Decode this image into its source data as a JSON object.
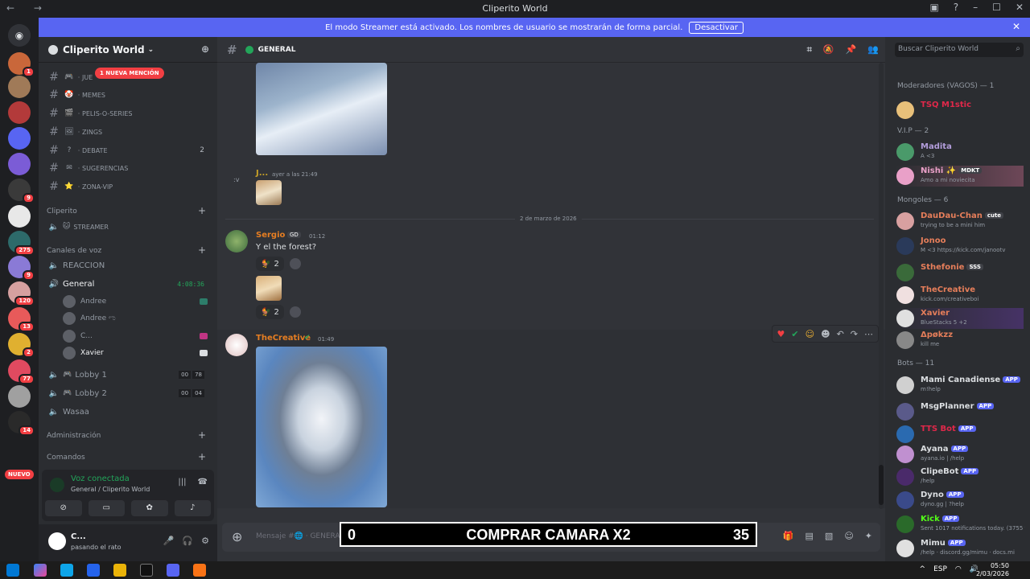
{
  "window": {
    "title": "Cliperito World",
    "nav": "← →"
  },
  "banner": {
    "text": "El modo Streamer está activado. Los nombres de usuario se mostrarán de forma parcial.",
    "button": "Desactivar"
  },
  "servers": [
    {
      "badge": "1",
      "color": "#c9673a"
    },
    {
      "badge": "",
      "color": "#a07a58"
    },
    {
      "badge": "",
      "color": "#b33a3a"
    },
    {
      "badge": "",
      "color": "#5865f2"
    },
    {
      "badge": "",
      "color": "#7b5cd6"
    },
    {
      "badge": "9",
      "color": "#3a3a3a"
    },
    {
      "badge": "",
      "color": "#e8e8e8"
    },
    {
      "badge": "275",
      "color": "#2d6a6a"
    },
    {
      "badge": "9",
      "color": "#8a7ad6"
    },
    {
      "badge": "120",
      "color": "#d6a0a0"
    },
    {
      "badge": "13",
      "color": "#e85a5a"
    },
    {
      "badge": "2",
      "color": "#e0b030"
    },
    {
      "badge": "77",
      "color": "#e04a60"
    },
    {
      "badge": "",
      "color": "#a0a0a0"
    },
    {
      "badge": "14",
      "color": "#2a2a2a"
    }
  ],
  "nuevo": "NUEVO",
  "guild": {
    "name": "Cliperito World"
  },
  "mention_pill": "1 NUEVA MENCIÓN",
  "channels": [
    {
      "icon": "🎮",
      "name": "JUE",
      "count": ""
    },
    {
      "icon": "🤡",
      "name": "MEMES",
      "count": ""
    },
    {
      "icon": "🎬",
      "name": "PELIS-O-SERIES",
      "count": ""
    },
    {
      "icon": "🖼",
      "name": "ZINGS",
      "count": ""
    },
    {
      "icon": "?",
      "name": "DEBATE",
      "count": "2"
    },
    {
      "icon": "✉",
      "name": "SUGERENCIAS",
      "count": ""
    },
    {
      "icon": "⭐",
      "name": "ZONA-VIP",
      "count": ""
    }
  ],
  "cliperito_cat": "Cliperito",
  "streamer": {
    "name": "STREAMER"
  },
  "voice_cat": "Canales de voz",
  "reaccion": "REACCION",
  "general_vc": {
    "name": "General",
    "time": "4:08:36"
  },
  "voice_users": [
    "Andree",
    "Andree ಌ",
    "C...",
    "Xavier"
  ],
  "lobbies": [
    {
      "name": "Lobby 1",
      "a": "00",
      "b": "78"
    },
    {
      "name": "Lobby 2",
      "a": "00",
      "b": "04"
    }
  ],
  "wasaa": "Wasaa",
  "admin_cat": "Administración",
  "cmd_cat": "Comandos",
  "voice_panel": {
    "status": "Voz conectada",
    "location": "General / Cliperito World"
  },
  "user": {
    "name": "C...",
    "status": "pasando el rato"
  },
  "chat": {
    "channel": "GENERAL",
    "date_divider": "2 de marzo de 2026",
    "msg1": {
      "author": "J...",
      "time": "ayer a las 21:49",
      "prefix": ":v"
    },
    "msg2": {
      "author": "Sergio",
      "badge": "GD",
      "time": "01:12",
      "text": "Y el the forest?",
      "r1": "2",
      "r2": "2"
    },
    "msg3": {
      "author": "TheCreative",
      "time": "01:49"
    },
    "placeholder": "Mensaje #🌐 · GENERAL"
  },
  "overlay": {
    "left": "0",
    "center": "COMPRAR CAMARA X2",
    "right": "35"
  },
  "members": {
    "search": "Buscar Cliperito World",
    "groups": [
      {
        "title": "Moderadores (VAGOS) — 1",
        "items": [
          {
            "name": "TSQ M1stic",
            "sub": "",
            "color": "#e0284a",
            "tag": ""
          }
        ]
      },
      {
        "title": "V.I.P — 2",
        "items": [
          {
            "name": "Madita",
            "sub": "A <3",
            "color": "#b39ddb",
            "tag": ""
          },
          {
            "name": "Nishi ✨",
            "sub": "Amo a mi noviecita",
            "color": "#e9a0c8",
            "tag": "MDKT"
          }
        ]
      },
      {
        "title": "Mongoles — 6",
        "items": [
          {
            "name": "DauDau-Chan",
            "sub": "trying to be a mini him",
            "color": "#e67e5a",
            "tag": "cute"
          },
          {
            "name": "Jonoo",
            "sub": "M <3 https://kick.com/janootv",
            "color": "#e67e5a",
            "tag": ""
          },
          {
            "name": "Sthefonie",
            "sub": "",
            "color": "#e67e5a",
            "tag": "SSS"
          },
          {
            "name": "TheCreative",
            "sub": "kick.com/creativeboi",
            "color": "#e67e5a",
            "tag": ""
          },
          {
            "name": "Xavier",
            "sub": "BlueStacks 5 +2",
            "color": "#e67e5a",
            "tag": ""
          },
          {
            "name": "Δpøkzz",
            "sub": "kill me",
            "color": "#e67e5a",
            "tag": ""
          }
        ]
      },
      {
        "title": "Bots — 11",
        "items": [
          {
            "name": "Mami Canadiense",
            "sub": "m!help",
            "color": "#dbdee1",
            "tag": "APP"
          },
          {
            "name": "MsgPlanner",
            "sub": "",
            "color": "#dbdee1",
            "tag": "APP"
          },
          {
            "name": "TTS Bot",
            "sub": "",
            "color": "#e0284a",
            "tag": "APP"
          },
          {
            "name": "Ayana",
            "sub": "ayana.io | /help",
            "color": "#dbdee1",
            "tag": "APP"
          },
          {
            "name": "ClipeBot",
            "sub": "/help",
            "color": "#dbdee1",
            "tag": "APP"
          },
          {
            "name": "Dyno",
            "sub": "dyno.gg | ?help",
            "color": "#dbdee1",
            "tag": "APP"
          },
          {
            "name": "Kick",
            "sub": "Sent 1017 notifications today. (3755 y",
            "color": "#53fc18",
            "tag": "APP"
          },
          {
            "name": "Mimu",
            "sub": "/help · discord.gg/mimu · docs.mi",
            "color": "#dbdee1",
            "tag": "APP"
          }
        ]
      }
    ]
  },
  "taskbar": {
    "lang": "ESP",
    "time": "05:50",
    "date": "2/03/2026"
  }
}
